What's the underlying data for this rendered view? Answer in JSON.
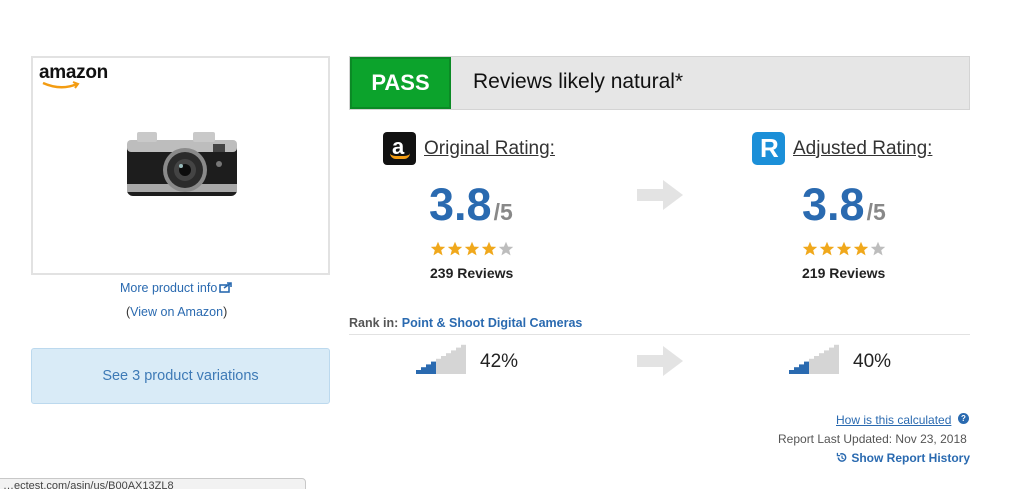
{
  "product": {
    "store_logo_text": "amazon",
    "more_info_label": "More product info",
    "view_on_amazon_prefix": "(",
    "view_on_amazon_label": "View on Amazon",
    "view_on_amazon_suffix": ")",
    "variations_label": "See 3 product variations"
  },
  "verdict": {
    "badge": "PASS",
    "text": "Reviews likely natural*",
    "badge_color": "#0ca32c"
  },
  "original": {
    "label": "Original Rating:",
    "icon": "amazon-icon",
    "score": "3.8",
    "denominator": "/5",
    "stars_filled": 4,
    "reviews": "239 Reviews",
    "rank_pct_text": "42%",
    "rank_fraction": 0.42
  },
  "adjusted": {
    "label": "Adjusted Rating:",
    "icon": "reviewmeta-icon",
    "score": "3.8",
    "denominator": "/5",
    "stars_filled": 4,
    "reviews": "219 Reviews",
    "rank_pct_text": "40%",
    "rank_fraction": 0.4
  },
  "rank": {
    "prefix": "Rank in:",
    "category": "Point & Shoot Digital Cameras"
  },
  "footer": {
    "calc_link": "How is this calculated",
    "updated": "Report Last Updated: Nov 23, 2018",
    "history": "Show Report History"
  },
  "status_bar": {
    "url": "…ectest.com/asin/us/B00AX13ZL8"
  },
  "colors": {
    "accent": "#2a6ab0",
    "star": "#f0a81c",
    "star_empty": "#bdbdbd",
    "rank_fill": "#2a6ab0",
    "rank_empty": "#d5d5d5"
  }
}
